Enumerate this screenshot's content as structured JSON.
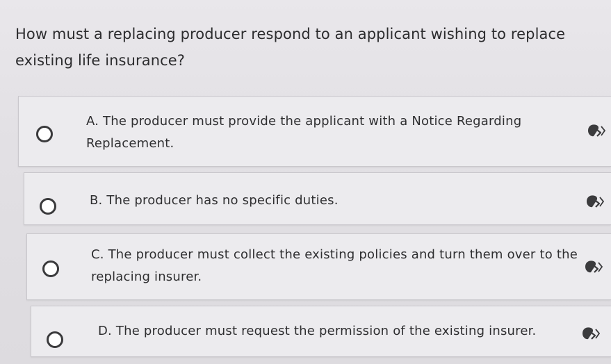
{
  "question": {
    "text": "How must a replacing producer respond to an applicant wishing to replace existing life insurance?"
  },
  "options": [
    {
      "letter": "A",
      "text": "A. The producer must provide the applicant with a Notice Regarding Replacement.",
      "selected": false,
      "icon": "read-aloud-icon"
    },
    {
      "letter": "B",
      "text": "B. The producer has no specific duties.",
      "selected": false,
      "icon": "read-aloud-icon"
    },
    {
      "letter": "C",
      "text": "C. The producer must collect the existing policies and turn them over to the replacing insurer.",
      "selected": false,
      "icon": "read-aloud-icon"
    },
    {
      "letter": "D",
      "text": "D. The producer must request the permission of the existing insurer.",
      "selected": false,
      "icon": "read-aloud-icon"
    }
  ],
  "colors": {
    "background": "#e5e3e7",
    "option_background": "#ecebee",
    "text": "#2c2c2e",
    "radio_border": "#3a3a3c"
  }
}
